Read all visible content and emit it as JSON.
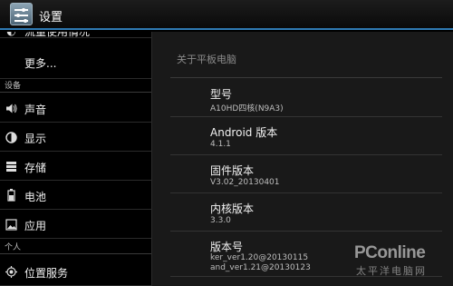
{
  "actionbar": {
    "title": "设置",
    "icon": "settings-sliders-icon"
  },
  "sidebar": {
    "partial_item": {
      "label": "流量使用情况",
      "icon": "data-usage-icon"
    },
    "more_item": {
      "label": "更多..."
    },
    "section_device": "设备",
    "device_items": [
      {
        "label": "声音",
        "icon": "sound-icon"
      },
      {
        "label": "显示",
        "icon": "display-icon"
      },
      {
        "label": "存储",
        "icon": "storage-icon"
      },
      {
        "label": "电池",
        "icon": "battery-icon"
      },
      {
        "label": "应用",
        "icon": "apps-icon"
      }
    ],
    "section_personal": "个人",
    "personal_items": [
      {
        "label": "位置服务",
        "icon": "location-icon"
      }
    ]
  },
  "detail": {
    "title": "关于平板电脑",
    "rows": [
      {
        "title": "型号",
        "value": "A10HD四核(N9A3)"
      },
      {
        "title": "Android 版本",
        "value": "4.1.1"
      },
      {
        "title": "固件版本",
        "value": "V3.02_20130401"
      },
      {
        "title": "内核版本",
        "value": "3.3.0"
      },
      {
        "title": "版本号",
        "value": "ker_ver1.20@20130115",
        "value2": "and_ver1.21@20130123"
      }
    ]
  },
  "watermark": {
    "line1": "PConline",
    "line2": "太平洋电脑网"
  }
}
